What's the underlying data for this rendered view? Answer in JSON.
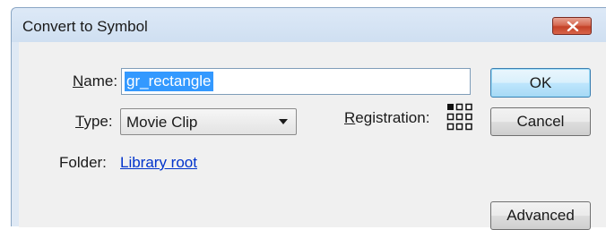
{
  "dialog": {
    "title": "Convert to Symbol",
    "close_icon": "close-x-icon"
  },
  "form": {
    "name_label_prefix": "N",
    "name_label_rest": "ame:",
    "name_value": "gr_rectangle",
    "type_label_prefix": "T",
    "type_label_rest": "ype:",
    "type_selected": "Movie Clip",
    "registration_label_prefix": "R",
    "registration_label_rest": "egistration:",
    "registration_selected": "top-left",
    "folder_label": "Folder:",
    "folder_link": "Library root"
  },
  "buttons": {
    "ok": "OK",
    "cancel": "Cancel",
    "advanced": "Advanced"
  },
  "colors": {
    "close_button": "#c44127",
    "selection": "#3399ff",
    "link": "#0033cc"
  }
}
